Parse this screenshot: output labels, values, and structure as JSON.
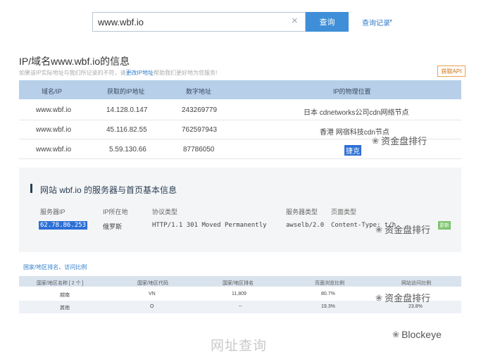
{
  "search": {
    "value": "www.wbf.io",
    "clear_icon": "×",
    "button_label": "查询",
    "history_label": "查询记录",
    "history_caret": "▾"
  },
  "ip_section": {
    "title": "IP/域名www.wbf.io的信息",
    "notice_prefix": "如果该IP实际地址与我们所记录的不符，请",
    "notice_link": "更改IP地址",
    "notice_suffix": "帮助我们更好地为您服务!",
    "api_button": "获取API",
    "headers": [
      "域名/IP",
      "获取的IP地址",
      "数字地址",
      "IP的物理位置"
    ],
    "rows": [
      {
        "domain": "www.wbf.io",
        "ip": "14.128.0.147",
        "number": "243269779",
        "location": "日本 cdnetworks公司cdn网络节点"
      },
      {
        "domain": "www.wbf.io",
        "ip": "45.116.82.55",
        "number": "762597943",
        "location": "香港 网宿科技cdn节点"
      },
      {
        "domain": "www.wbf.io",
        "ip": "5.59.130.66",
        "number": "87786050",
        "location": "捷克"
      }
    ]
  },
  "server_section": {
    "title": "网站 wbf.io 的服务器与首页基本信息",
    "headers": [
      "服务器IP",
      "IP所在地",
      "协议类型",
      "服务器类型",
      "页面类型"
    ],
    "row": {
      "ip": "62.78.86.253",
      "location": "俄罗斯",
      "protocol": "HTTP/1.1 301 Moved Permanently",
      "server": "awselb/2.0",
      "page_type": "Content-Type: t/h",
      "tag": "更新"
    }
  },
  "country_section": {
    "title": "国家/地区排名、访问比例",
    "headers": [
      "国家/地区名称 [ 2 个 ]",
      "国家/地区代码",
      "国家/地区排名",
      "页面浏览比例",
      "网站访问比例"
    ],
    "rows": [
      {
        "name": "越南",
        "code": "VN",
        "rank": "11,809",
        "page_ratio": "80.7%",
        "visit_ratio": ""
      },
      {
        "name": "其他",
        "code": "O",
        "rank": "--",
        "page_ratio": "19.3%",
        "visit_ratio": "23.8%"
      }
    ]
  },
  "watermarks": {
    "label": "资金盘排行",
    "logo": "❀",
    "brand": "Blockeye"
  },
  "footer_text": "网址查询",
  "colors": {
    "accent": "#3f8fd8",
    "table_header": "#b7cfe9",
    "highlight": "#2d6fd6"
  }
}
